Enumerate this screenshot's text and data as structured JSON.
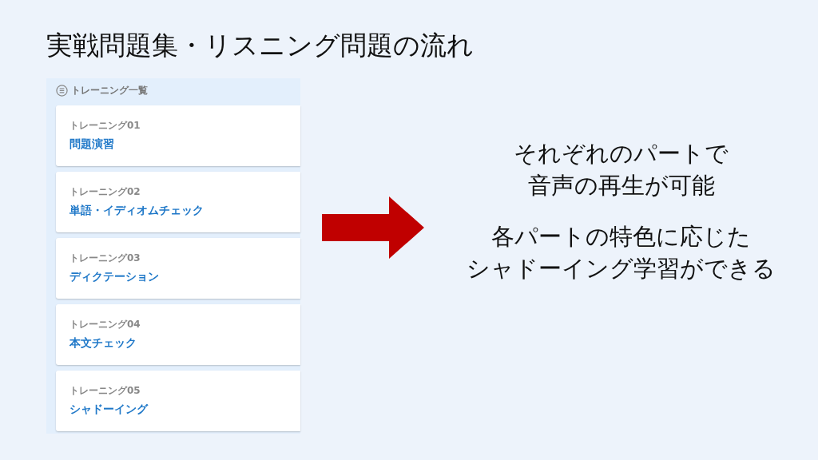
{
  "title": "実戦問題集・リスニング問題の流れ",
  "panel": {
    "header": "トレーニング一覧",
    "items": [
      {
        "label": "トレーニング01",
        "name": "問題演習"
      },
      {
        "label": "トレーニング02",
        "name": "単語・イディオムチェック"
      },
      {
        "label": "トレーニング03",
        "name": "ディクテーション"
      },
      {
        "label": "トレーニング04",
        "name": "本文チェック"
      },
      {
        "label": "トレーニング05",
        "name": "シャドーイング"
      }
    ]
  },
  "notes": [
    [
      "それぞれのパートで",
      "音声の再生が可能"
    ],
    [
      "各パートの特色に応じた",
      "シャドーイング学習ができる"
    ]
  ]
}
